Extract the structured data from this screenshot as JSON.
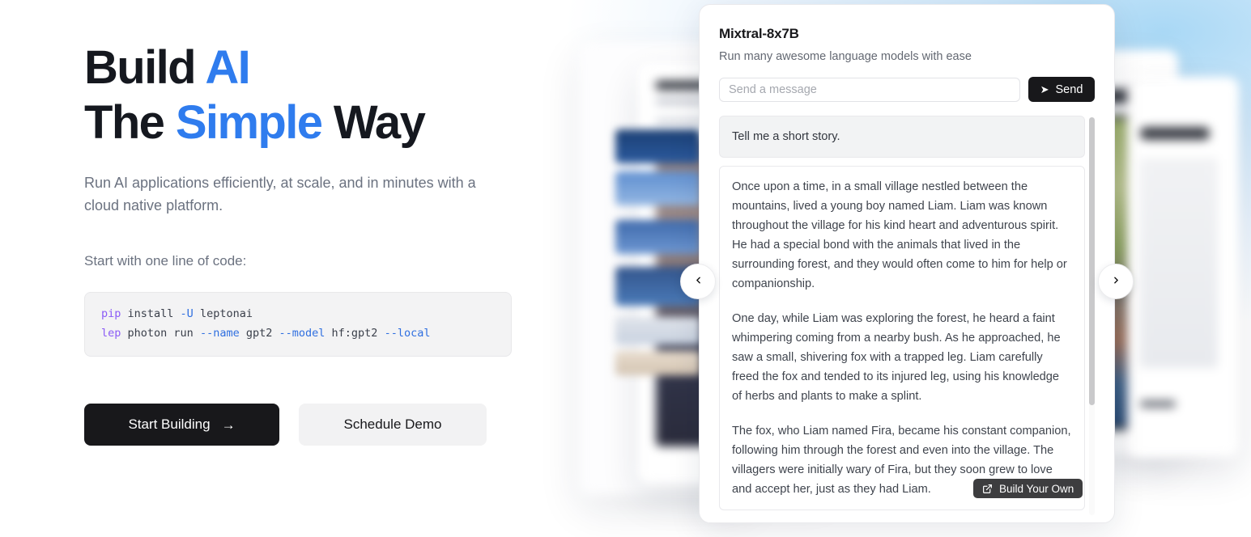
{
  "hero": {
    "headline_line1_plain": "Build ",
    "headline_line1_accent": "AI",
    "headline_line2_plain_a": "The ",
    "headline_line2_accent": "Simple",
    "headline_line2_plain_b": " Way",
    "subhead": "Run AI applications efficiently, at scale, and in minutes with a cloud native platform.",
    "start_label": "Start with one line of code:",
    "code": {
      "line1": {
        "kw": "pip",
        "rest1": " install ",
        "flag": "-U",
        "rest2": " leptonai"
      },
      "line2": {
        "kw": "lep",
        "rest1": " photon run ",
        "flag1": "--name",
        "rest2": " gpt2 ",
        "flag2": "--model",
        "rest3": " hf:gpt2 ",
        "flag3": "--local"
      }
    },
    "primary_button": "Start Building",
    "primary_button_icon": "arrow-right-icon",
    "primary_button_arrow": "→",
    "secondary_button": "Schedule Demo"
  },
  "accent_color": "#2f7cee",
  "card": {
    "title": "Mixtral-8x7B",
    "subtitle": "Run many awesome language models with ease",
    "input_placeholder": "Send a message",
    "input_value": "",
    "send_label": "Send",
    "send_icon": "paper-plane-icon",
    "user_message": "Tell me a short story.",
    "bot_message_p1": "Once upon a time, in a small village nestled between the mountains, lived a young boy named Liam. Liam was known throughout the village for his kind heart and adventurous spirit. He had a special bond with the animals that lived in the surrounding forest, and they would often come to him for help or companionship.",
    "bot_message_p2": "One day, while Liam was exploring the forest, he heard a faint whimpering coming from a nearby bush. As he approached, he saw a small, shivering fox with a trapped leg. Liam carefully freed the fox and tended to its injured leg, using his knowledge of herbs and plants to make a splint.",
    "bot_message_p3": "The fox, who Liam named Fira, became his constant companion, following him through the forest and even into the village. The villagers were initially wary of Fira, but they soon grew to love and accept her, just as they had Liam."
  },
  "carousel": {
    "prev_icon": "chevron-left-icon",
    "prev_glyph": "‹",
    "next_icon": "chevron-right-icon",
    "next_glyph": "›"
  },
  "build_own": {
    "label": "Build Your Own",
    "icon": "external-link-icon"
  }
}
